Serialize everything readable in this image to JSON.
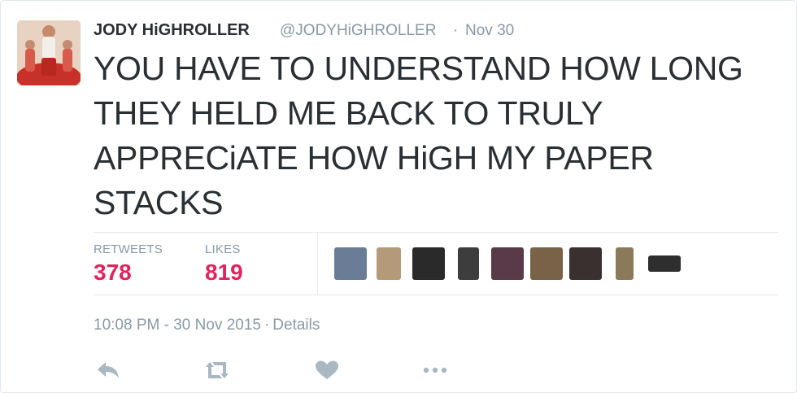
{
  "tweet": {
    "display_name": "JODY HiGHROLLER",
    "handle": "@JODYHiGHROLLER",
    "separator": "·",
    "time_ago": "Nov 30",
    "text": "YOU HAVE TO UNDERSTAND HOW LONG THEY HELD ME BACK TO TRULY APPRECiATE HOW HiGH MY PAPER STACKS"
  },
  "stats": {
    "retweets_label": "RETWEETS",
    "retweets_value": "378",
    "likes_label": "LIKES",
    "likes_value": "819"
  },
  "likers": [
    {
      "name": "liker-avatar-1",
      "color": "#6b7d96"
    },
    {
      "name": "liker-avatar-2",
      "color": "#b59a7a"
    },
    {
      "name": "liker-avatar-3",
      "color": "#2a2a2a"
    },
    {
      "name": "liker-avatar-4",
      "color": "#3d3d3d"
    },
    {
      "name": "liker-avatar-5",
      "color": "#5a3a48"
    },
    {
      "name": "liker-avatar-6",
      "color": "#7a6248"
    },
    {
      "name": "liker-avatar-7",
      "color": "#3a3030"
    },
    {
      "name": "liker-avatar-8",
      "color": "#8a7a5a"
    },
    {
      "name": "liker-avatar-9",
      "color": "#2e2e2e"
    }
  ],
  "meta": {
    "timestamp": "10:08 PM - 30 Nov 2015",
    "separator": "·",
    "details_link": "Details"
  },
  "actions": {
    "icon_color": "#aab8c2",
    "reply": "reply-icon",
    "retweet": "retweet-icon",
    "like": "heart-icon",
    "more": "more-icon"
  },
  "colors": {
    "stat_value": "#e0245e",
    "secondary_text": "#8899a6",
    "primary_text": "#292f33",
    "border": "#e1e8ed"
  }
}
